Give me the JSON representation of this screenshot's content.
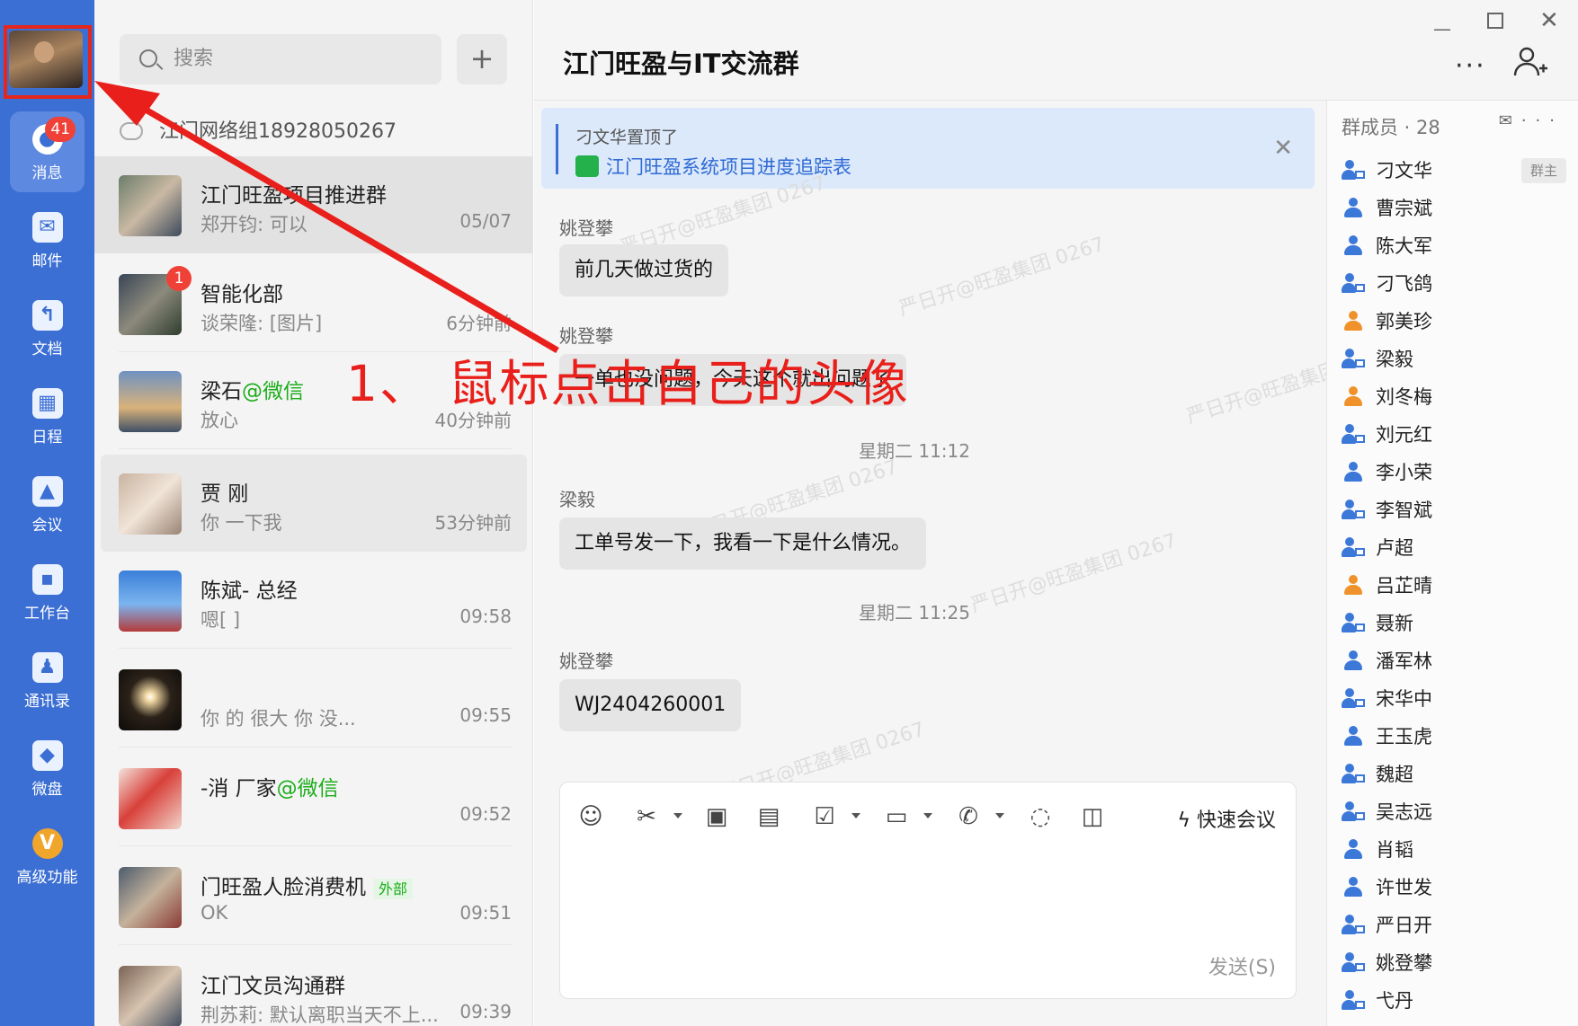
{
  "nav": {
    "badge": "41",
    "items": [
      {
        "label": "消息",
        "icon": "chat-bubble-icon"
      },
      {
        "label": "邮件",
        "icon": "mail-icon"
      },
      {
        "label": "文档",
        "icon": "document-icon"
      },
      {
        "label": "日程",
        "icon": "calendar-icon"
      },
      {
        "label": "会议",
        "icon": "meeting-icon"
      },
      {
        "label": "工作台",
        "icon": "workbench-icon"
      },
      {
        "label": "通讯录",
        "icon": "contacts-icon"
      },
      {
        "label": "微盘",
        "icon": "drive-icon"
      },
      {
        "label": "高级功能",
        "icon": "premium-icon"
      }
    ]
  },
  "list": {
    "search_placeholder": "搜索",
    "notice": "江门网络组18928050267",
    "conversations": [
      {
        "name": "江门旺盈项目推进群",
        "preview": "郑开钧: 可以",
        "time": "05/07"
      },
      {
        "name": "智能化部",
        "preview": "谈荣隆: [图片]",
        "time": "6分钟前",
        "badge": "1"
      },
      {
        "name": "梁石",
        "name_suffix": "@微信",
        "preview": "放心",
        "time": "40分钟前"
      },
      {
        "name": "贾 刚",
        "preview": " 你 一下我",
        "time": "53分钟前"
      },
      {
        "name": "陈斌- 总经",
        "preview": "嗯[ ]",
        "time": "09:58"
      },
      {
        "name": "",
        "preview": "你 的 很大 你 没...",
        "time": "09:55"
      },
      {
        "name": "-消 厂家",
        "name_suffix": "@微信",
        "preview": "",
        "time": "09:52"
      },
      {
        "name": "门旺盈人脸消费机",
        "tag": "外部",
        "preview": "OK",
        "time": "09:51"
      },
      {
        "name": "江门文员沟通群",
        "preview": "荆苏莉: 默认离职当天不上...",
        "time": "09:39"
      }
    ]
  },
  "chat": {
    "title": "江门旺盈与IT交流群",
    "pinned_by": "刁文华置顶了",
    "pinned_doc": "江门旺盈系统项目进度追踪表",
    "messages": [
      {
        "sender": "姚登攀",
        "text": "前几天做过货的"
      },
      {
        "sender": "姚登攀",
        "text": "一单也没问题，今天这个就出问题了"
      },
      {
        "time": "星期二 11:12"
      },
      {
        "sender": "梁毅",
        "text": "工单号发一下，我看一下是什么情况。"
      },
      {
        "time": "星期二 11:25"
      },
      {
        "sender": "姚登攀",
        "text": "WJ2404260001"
      }
    ],
    "watermark": "严日开@旺盈集团 0267",
    "quick_meeting": "快速会议",
    "send": "发送(S)"
  },
  "members": {
    "header": "群成员 · 28",
    "owner_tag": "群主",
    "list": [
      {
        "name": "刁文华",
        "style": "mobile"
      },
      {
        "name": "曹宗斌",
        "style": "blue"
      },
      {
        "name": "陈大军",
        "style": "blue"
      },
      {
        "name": "刁飞鸽",
        "style": "mobile"
      },
      {
        "name": "郭美珍",
        "style": "orange"
      },
      {
        "name": "梁毅",
        "style": "mobile"
      },
      {
        "name": "刘冬梅",
        "style": "orange"
      },
      {
        "name": "刘元红",
        "style": "mobile"
      },
      {
        "name": "李小荣",
        "style": "blue"
      },
      {
        "name": "李智斌",
        "style": "mobile"
      },
      {
        "name": "卢超",
        "style": "mobile"
      },
      {
        "name": "吕芷晴",
        "style": "orange"
      },
      {
        "name": "聂新",
        "style": "mobile"
      },
      {
        "name": "潘军林",
        "style": "blue"
      },
      {
        "name": "宋华中",
        "style": "mobile"
      },
      {
        "name": "王玉虎",
        "style": "blue"
      },
      {
        "name": "魏超",
        "style": "mobile"
      },
      {
        "name": "吴志远",
        "style": "mobile"
      },
      {
        "name": "肖韬",
        "style": "blue"
      },
      {
        "name": "许世发",
        "style": "blue"
      },
      {
        "name": "严日开",
        "style": "mobile"
      },
      {
        "name": "姚登攀",
        "style": "mobile"
      },
      {
        "name": "弋丹",
        "style": "mobile"
      }
    ]
  },
  "annotation": "1、 鼠标点击自己的头像",
  "colors": {
    "sidebar": "#3c6fd3",
    "annotation": "#e81f1a",
    "pin_bg": "#dbe9fb",
    "wechat": "#1aad19"
  }
}
